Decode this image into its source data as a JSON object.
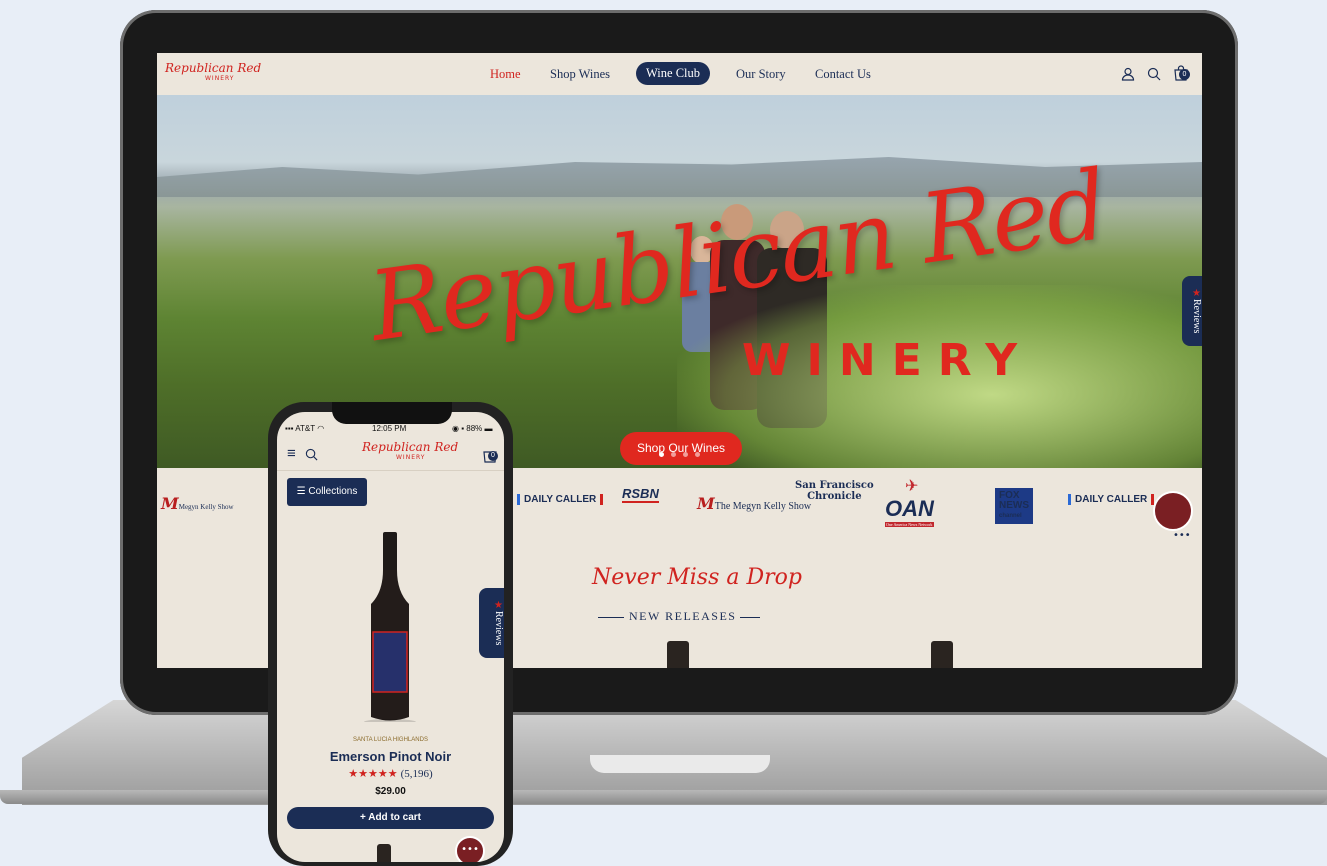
{
  "desktop": {
    "logo": {
      "script": "Republican Red",
      "sub": "WINERY"
    },
    "nav": [
      {
        "label": "Home"
      },
      {
        "label": "Shop Wines"
      },
      {
        "label": "Wine Club"
      },
      {
        "label": "Our Story"
      },
      {
        "label": "Contact Us"
      }
    ],
    "cart_count": "0",
    "hero": {
      "title": "Republican Red",
      "subtitle": "WINERY",
      "cta": "Shop Our Wines"
    },
    "reviews_tab": "Reviews",
    "media": {
      "megyn": "Megyn Kelly Show",
      "megyn2": "The Megyn Kelly Show",
      "sf": "San Francisco",
      "sf2": "Chronicle",
      "dc": "DAILY CALLER",
      "rsbn": "RSBN",
      "oan": "OAN",
      "oan_sub": "One America News Network",
      "fox1": "FOX",
      "fox2": "NEWS",
      "fox3": "channel"
    },
    "section": {
      "title": "Never Miss a Drop",
      "subtitle": "NEW RELEASES"
    }
  },
  "phone": {
    "status": {
      "carrier": "AT&T",
      "time": "12:05 PM",
      "battery": "88%"
    },
    "logo": {
      "script": "Republican Red",
      "sub": "WINERY"
    },
    "cart_count": "0",
    "collections": "Collections",
    "reviews_tab": "Reviews",
    "product": {
      "region": "SANTA LUCIA HIGHLANDS",
      "name": "Emerson Pinot Noir",
      "stars": "★★★★★",
      "reviews": "(5,196)",
      "price": "$29.00",
      "add": "+ Add to cart"
    },
    "colors": {
      "red": "#d0231f",
      "navy": "#1b2d55",
      "cream": "#ece6dc"
    }
  }
}
